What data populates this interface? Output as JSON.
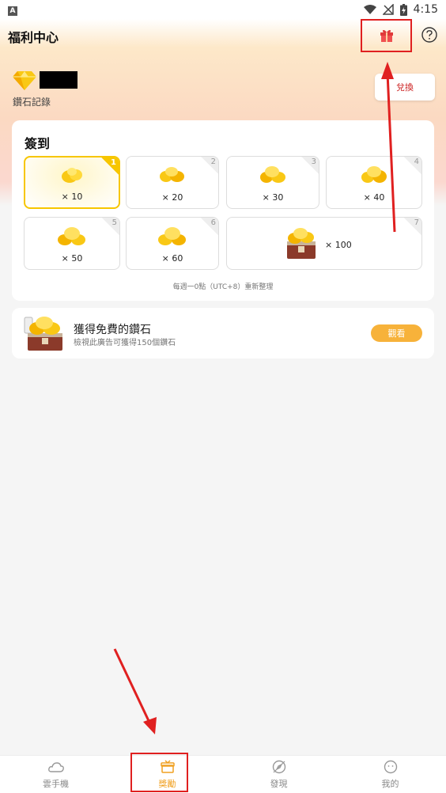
{
  "status_bar": {
    "time": "4:15",
    "notification_letter": "A"
  },
  "header": {
    "title": "福利中心"
  },
  "diamonds": {
    "record_label": "鑽石記錄",
    "exchange_label": "兌換"
  },
  "checkin": {
    "title": "簽到",
    "days": [
      {
        "day": "1",
        "amount": "× 10",
        "active": true
      },
      {
        "day": "2",
        "amount": "× 20"
      },
      {
        "day": "3",
        "amount": "× 30"
      },
      {
        "day": "4",
        "amount": "× 40"
      },
      {
        "day": "5",
        "amount": "× 50"
      },
      {
        "day": "6",
        "amount": "× 60"
      },
      {
        "day": "7",
        "amount": "× 100"
      }
    ],
    "reset_note": "每週一0點（UTC+8）重新整理"
  },
  "ad": {
    "title": "獲得免費的鑽石",
    "subtitle": "檢視此廣告可獲得150個鑽石",
    "watch_label": "觀看"
  },
  "tabs": [
    {
      "label": "雲手機",
      "icon": "cloud-phone-icon"
    },
    {
      "label": "獎勵",
      "icon": "gift-box-icon",
      "active": true
    },
    {
      "label": "發現",
      "icon": "compass-icon"
    },
    {
      "label": "我的",
      "icon": "profile-icon"
    }
  ],
  "colors": {
    "accent": "#f0a020",
    "annotation": "#e02020",
    "gold": "#f7c600"
  }
}
